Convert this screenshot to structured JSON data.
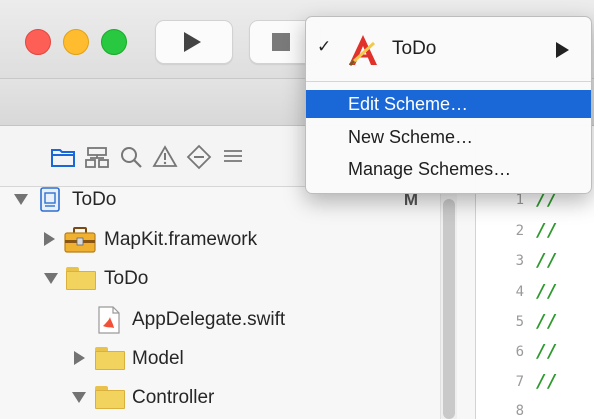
{
  "scheme_menu": {
    "current_scheme": "ToDo",
    "check_glyph": "✓",
    "items": [
      "Edit Scheme…",
      "New Scheme…",
      "Manage Schemes…"
    ],
    "highlighted_index": 0
  },
  "navigator": {
    "rows": [
      {
        "label": "ToDo",
        "badge": "M",
        "icon": "project-file-icon",
        "expanded": true
      },
      {
        "label": "MapKit.framework",
        "icon": "framework-toolbox-icon",
        "expanded": false
      },
      {
        "label": "ToDo",
        "icon": "folder-icon",
        "expanded": true
      },
      {
        "label": "AppDelegate.swift",
        "icon": "swift-file-icon"
      },
      {
        "label": "Model",
        "icon": "folder-icon",
        "expanded": false
      },
      {
        "label": "Controller",
        "icon": "folder-icon",
        "expanded": true
      }
    ]
  },
  "editor": {
    "line_numbers": [
      "1",
      "2",
      "3",
      "4",
      "5",
      "6",
      "7",
      "8"
    ],
    "code_lines": [
      "//",
      "//",
      "//",
      "//",
      "//",
      "//",
      "//"
    ]
  },
  "colors": {
    "close": "#fd5f57",
    "minimize": "#febc2e",
    "zoom": "#28c840",
    "menu_highlight": "#1a67d8",
    "comment": "#2e9a2e"
  }
}
